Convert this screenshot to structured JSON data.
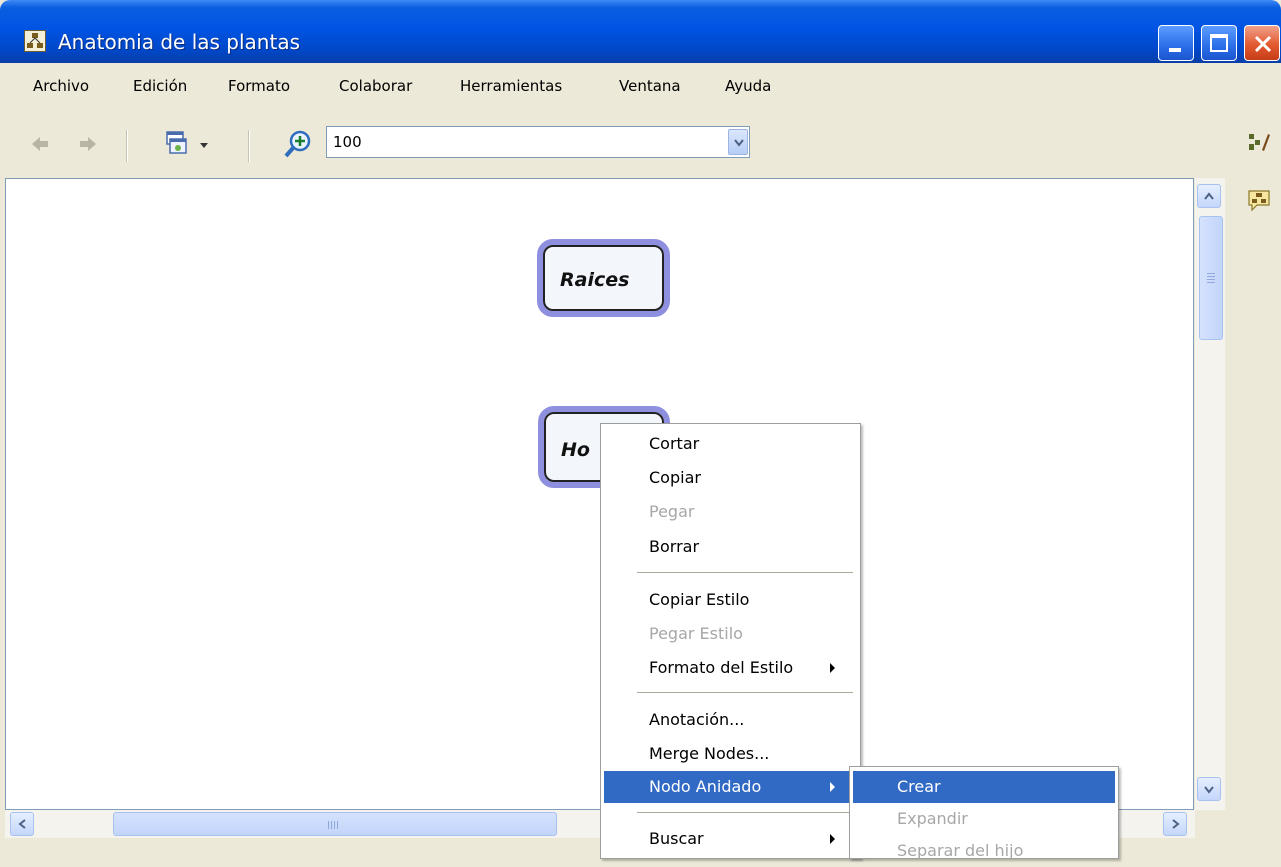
{
  "window": {
    "title": "Anatomia de las plantas"
  },
  "menubar": {
    "items": [
      "Archivo",
      "Edición",
      "Formato",
      "Colaborar",
      "Herramientas",
      "Ventana",
      "Ayuda"
    ]
  },
  "toolbar": {
    "zoom_value": "100"
  },
  "nodes": [
    {
      "label": "Raices"
    },
    {
      "label": "Ho"
    }
  ],
  "context_menu": {
    "items": [
      {
        "label": "Cortar",
        "enabled": true
      },
      {
        "label": "Copiar",
        "enabled": true
      },
      {
        "label": "Pegar",
        "enabled": false
      },
      {
        "label": "Borrar",
        "enabled": true
      },
      {
        "label": "Copiar Estilo",
        "enabled": true
      },
      {
        "label": "Pegar Estilo",
        "enabled": false
      },
      {
        "label": "Formato del Estilo",
        "enabled": true,
        "submenu": true
      },
      {
        "label": "Anotación...",
        "enabled": true
      },
      {
        "label": "Merge Nodes...",
        "enabled": true
      },
      {
        "label": "Nodo Anidado",
        "enabled": true,
        "submenu": true,
        "highlighted": true
      },
      {
        "label": "Buscar",
        "enabled": true,
        "submenu": true
      }
    ]
  },
  "submenu": {
    "items": [
      {
        "label": "Crear",
        "enabled": true,
        "highlighted": true
      },
      {
        "label": "Expandir",
        "enabled": false
      },
      {
        "label": "Separar del hijo",
        "enabled": false
      }
    ]
  },
  "colors": {
    "titlebar": "#0054e3",
    "highlight": "#316ac5",
    "node_border": "#8f8fe0",
    "disabled_text": "#a7a7a7"
  }
}
